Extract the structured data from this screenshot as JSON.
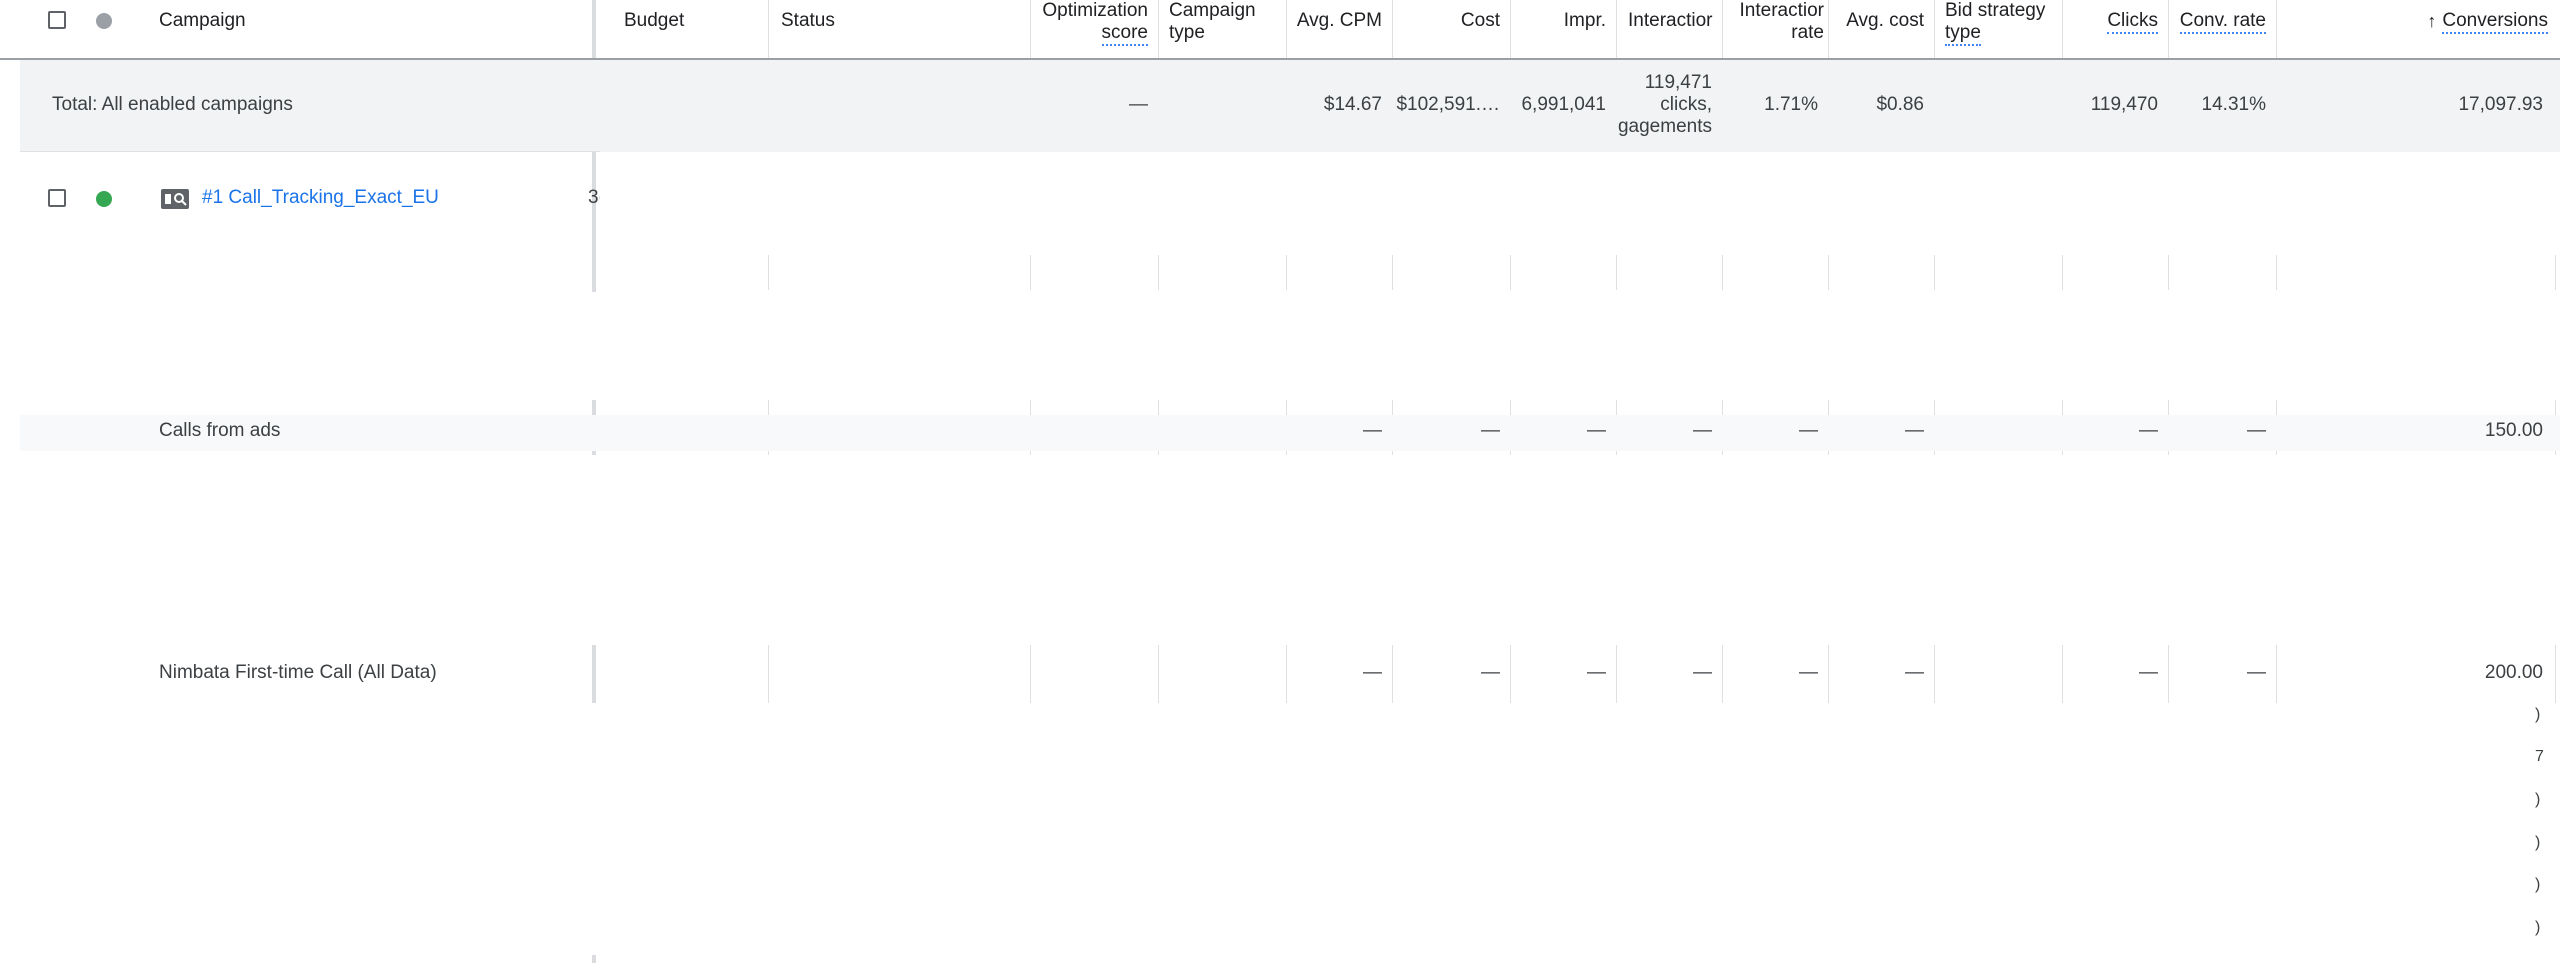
{
  "header": {
    "campaign": "Campaign",
    "budget": "Budget",
    "status": "Status",
    "optimization_score_1": "Optimization",
    "optimization_score_2": "score",
    "campaign_type_1": "Campaign",
    "campaign_type_2": "type",
    "avg_cpm": "Avg. CPM",
    "cost": "Cost",
    "impr": "Impr.",
    "interactions": "Interactior",
    "interaction_rate_1": "Interactior",
    "interaction_rate_2": "rat⁠e",
    "avg_cost": "Avg. cost",
    "bid_strategy_1": "Bid strategy",
    "bid_strategy_2": "type",
    "clicks": "Clicks",
    "conv_rate": "Conv. rate",
    "conversions_arrow": "↑",
    "conversions": "Conversions"
  },
  "total": {
    "label": "Total: All enabled campaigns",
    "optimization_score": "—",
    "avg_cpm": "$14.67",
    "cost": "$102,591.…",
    "impr": "6,991,041",
    "interactions_1": "119,471",
    "interactions_2": "clicks,",
    "interactions_3": "gagements",
    "interaction_rate": "1.71%",
    "avg_cost": "$0.86",
    "clicks": "119,470",
    "conv_rate": "14.31%",
    "conversions": "17,097.93"
  },
  "campaign_row": {
    "name": "#1 Call_Tracking_Exact_EU",
    "budget_partial": "3("
  },
  "calls_row": {
    "label": "Calls from ads",
    "avg_cpm": "—",
    "cost": "—",
    "impr": "—",
    "interactions": "—",
    "interaction_rate": "—",
    "avg_cost": "—",
    "clicks": "—",
    "conv_rate": "—",
    "conversions": "150.00"
  },
  "nimbata_row": {
    "label": "Nimbata First-time Call (All Data)",
    "avg_cpm": "—",
    "cost": "—",
    "impr": "—",
    "interactions": "—",
    "interaction_rate": "—",
    "avg_cost": "—",
    "clicks": "—",
    "conv_rate": "—",
    "conversions": "200.00"
  },
  "edge_glyphs": [
    ")",
    "7",
    ")",
    ")",
    ")",
    ")"
  ],
  "colors": {
    "status_enabled": "#34a853",
    "status_header_dot": "#9aa0a6",
    "link": "#1a73e8"
  },
  "icons": {
    "campaign_type": "search-campaign-icon",
    "sort": "arrow-up-icon"
  }
}
